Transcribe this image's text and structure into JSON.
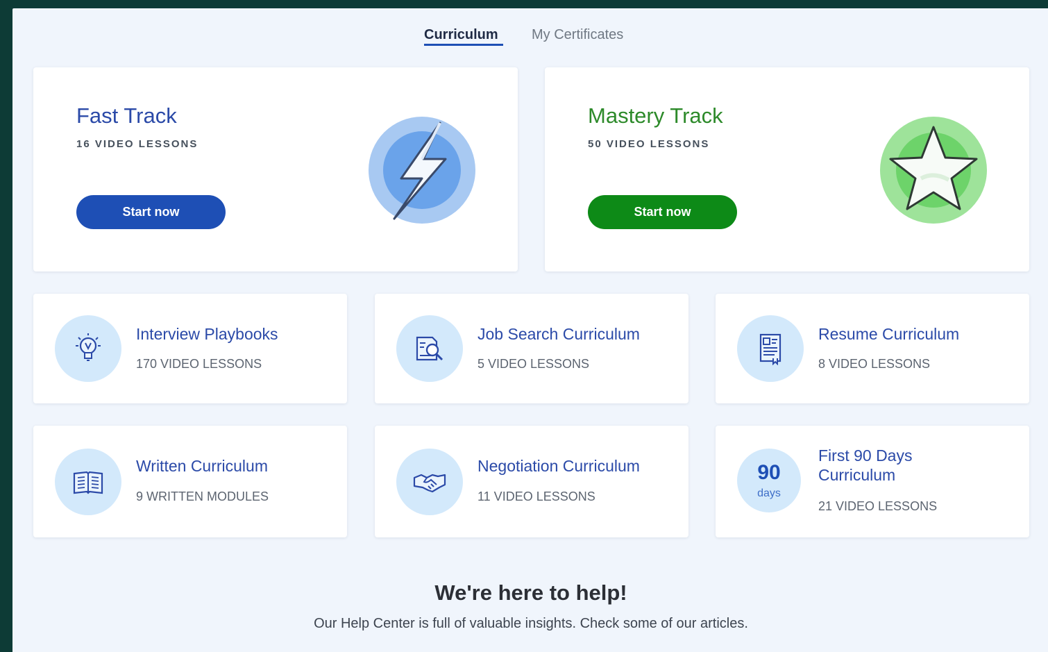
{
  "tabs": [
    {
      "label": "Curriculum",
      "active": true
    },
    {
      "label": "My Certificates",
      "active": false
    }
  ],
  "tracks": [
    {
      "title": "Fast Track",
      "lessons": "16 VIDEO LESSONS",
      "button": "Start now",
      "color": "#1e4fb5",
      "icon": "lightning-icon"
    },
    {
      "title": "Mastery Track",
      "lessons": "50 VIDEO LESSONS",
      "button": "Start now",
      "color": "#0d8a17",
      "icon": "star-icon"
    }
  ],
  "curricula": [
    {
      "title": "Interview Playbooks",
      "lessons": "170 VIDEO LESSONS",
      "icon": "lightbulb-icon"
    },
    {
      "title": "Job Search Curriculum",
      "lessons": "5 VIDEO LESSONS",
      "icon": "document-search-icon"
    },
    {
      "title": "Resume Curriculum",
      "lessons": "8 VIDEO LESSONS",
      "icon": "resume-icon"
    },
    {
      "title": "Written Curriculum",
      "lessons": "9 WRITTEN MODULES",
      "icon": "open-book-icon"
    },
    {
      "title": "Negotiation Curriculum",
      "lessons": "11 VIDEO LESSONS",
      "icon": "handshake-icon"
    },
    {
      "title_line1": "First 90 Days",
      "title_line2": "Curriculum",
      "lessons": "21 VIDEO LESSONS",
      "badge_number": "90",
      "badge_label": "days"
    }
  ],
  "help": {
    "title": "We're here to help!",
    "subtitle": "Our Help Center is full of valuable insights. Check some of our articles."
  }
}
